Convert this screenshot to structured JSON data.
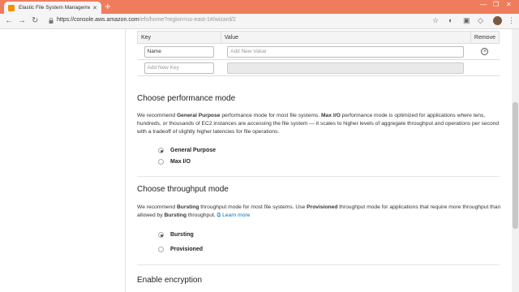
{
  "browser": {
    "tab_title": "Elastic File System Management",
    "url_host": "https://console.aws.amazon.com",
    "url_path": "/efs/home?region=us-east-1#/wizard/2"
  },
  "tags": {
    "headers": [
      "Key",
      "Value",
      "Remove"
    ],
    "row1": {
      "key": "Name",
      "value_placeholder": "Add New Value"
    },
    "row2": {
      "key_placeholder": "Add New Key"
    }
  },
  "performance": {
    "title": "Choose performance mode",
    "desc_1": "We recommend ",
    "desc_b1": "General Purpose",
    "desc_2": " performance mode for most file systems. ",
    "desc_b2": "Max I/O",
    "desc_3": " performance mode is optimized for applications where tens, hundreds, or thousands of EC2 instances are accessing the file system — it scales to higher levels of aggregate throughput and operations per second with a tradeoff of slightly higher latencies for file operations.",
    "options": [
      "General Purpose",
      "Max I/O"
    ],
    "selected": "General Purpose"
  },
  "throughput": {
    "title": "Choose throughput mode",
    "desc_1": "We recommend ",
    "desc_b1": "Bursting",
    "desc_2": " throughput mode for most file systems. Use ",
    "desc_b2": "Provisioned",
    "desc_3": " throughput mode for applications that require more throughput than allowed by ",
    "desc_b3": "Bursting",
    "desc_4": " throughput. ",
    "learn_more": "Learn more",
    "options": [
      "Bursting",
      "Provisioned"
    ],
    "selected": "Bursting"
  },
  "encryption": {
    "title": "Enable encryption"
  }
}
